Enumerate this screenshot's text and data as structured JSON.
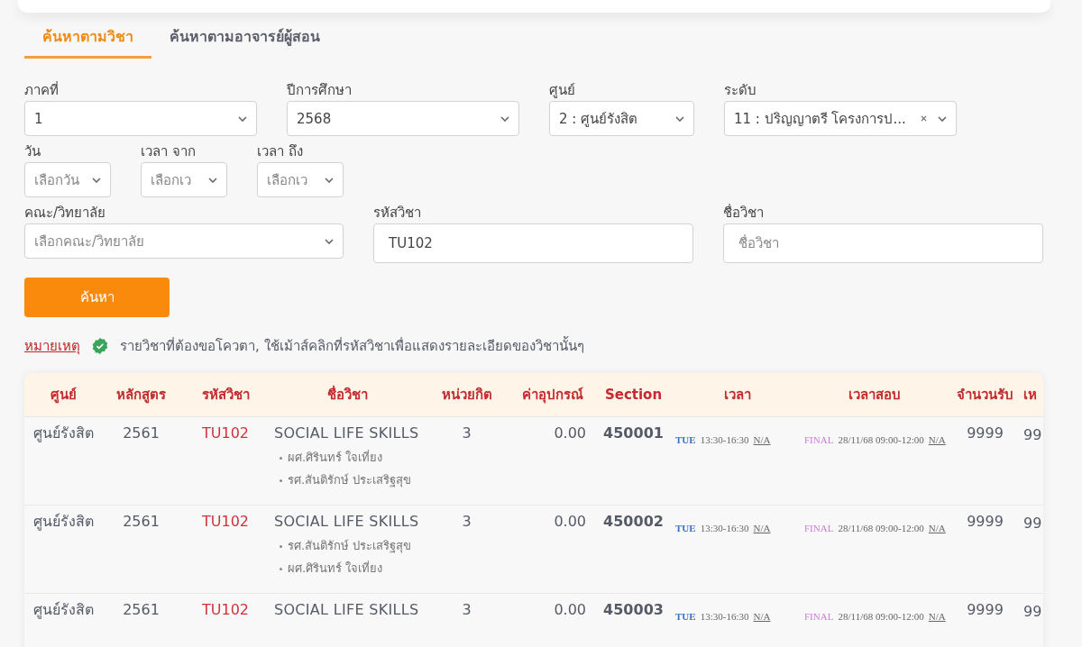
{
  "tabs": [
    {
      "label": "ค้นหาตามวิชา",
      "selected": true
    },
    {
      "label": "ค้นหาตามอาจารย์ผู้สอน",
      "selected": false
    }
  ],
  "filters_row1": [
    {
      "label": "ภาคที่",
      "value": "1"
    },
    {
      "label": "ปีการศึกษา",
      "value": "2568"
    },
    {
      "label": "ศูนย์",
      "value": "2 : ศูนย์รังสิต"
    },
    {
      "label": "ระดับ",
      "value": "11 : ปริญญาตรี โครงการป...",
      "clearable": true
    }
  ],
  "filters_row2": [
    {
      "label": "วัน",
      "placeholder": "เลือกวัน"
    },
    {
      "label": "เวลา จาก",
      "placeholder": "เลือกเว"
    },
    {
      "label": "เวลา ถึง",
      "placeholder": "เลือกเว"
    }
  ],
  "filters_row3": [
    {
      "label": "คณะ/วิทยาลัย",
      "kind": "select",
      "placeholder": "เลือกคณะ/วิทยาลัย"
    },
    {
      "label": "รหัสวิชา",
      "kind": "text",
      "value": "TU102"
    },
    {
      "label": "ชื่อวิชา",
      "kind": "text",
      "placeholder": "ชื่อวิชา"
    }
  ],
  "search_button": "ค้นหา",
  "note": {
    "link": "หมายเหตุ",
    "text": "รายวิชาที่ต้องขอโควตา, ใช้เม้าส์คลิกที่รหัสวิชาเพื่อแสดงรายละเอียดของวิชานั้นๆ"
  },
  "table": {
    "columns": [
      "ศูนย์",
      "หลักสูตร",
      "รหัสวิชา",
      "ชื่อวิชา",
      "หน่วยกิต",
      "ค่าอุปกรณ์",
      "Section",
      "เวลา",
      "เวลาสอบ",
      "จำนวนรับ",
      "เห"
    ],
    "rows": [
      {
        "center": "ศูนย์รังสิต",
        "curriculum": "2561",
        "code": "TU102",
        "name": "SOCIAL LIFE SKILLS",
        "instructors": [
          "ผศ.ศิรินทร์ ใจเที่ยง",
          "รศ.สันติรักษ์ ประเสริฐสุข"
        ],
        "credits": "3",
        "fee": "0.00",
        "section": "450001",
        "time": {
          "day": "TUE",
          "range": "13:30-16:30",
          "room": "N/A"
        },
        "exam": {
          "label": "FINAL",
          "datetime": "28/11/68 09:00-12:00",
          "room": "N/A"
        },
        "seats": "9999",
        "column_11": "99"
      },
      {
        "center": "ศูนย์รังสิต",
        "curriculum": "2561",
        "code": "TU102",
        "name": "SOCIAL LIFE SKILLS",
        "instructors": [
          "รศ.สันติรักษ์ ประเสริฐสุข",
          "ผศ.ศิรินทร์ ใจเที่ยง"
        ],
        "credits": "3",
        "fee": "0.00",
        "section": "450002",
        "time": {
          "day": "TUE",
          "range": "13:30-16:30",
          "room": "N/A"
        },
        "exam": {
          "label": "FINAL",
          "datetime": "28/11/68 09:00-12:00",
          "room": "N/A"
        },
        "seats": "9999",
        "column_11": "99"
      },
      {
        "center": "ศูนย์รังสิต",
        "curriculum": "2561",
        "code": "TU102",
        "name": "SOCIAL LIFE SKILLS",
        "instructors": [],
        "credits": "3",
        "fee": "0.00",
        "section": "450003",
        "time": {
          "day": "TUE",
          "range": "13:30-16:30",
          "room": "N/A"
        },
        "exam": {
          "label": "FINAL",
          "datetime": "28/11/68 09:00-12:00",
          "room": "N/A"
        },
        "seats": "9999",
        "column_11": "99"
      }
    ]
  }
}
